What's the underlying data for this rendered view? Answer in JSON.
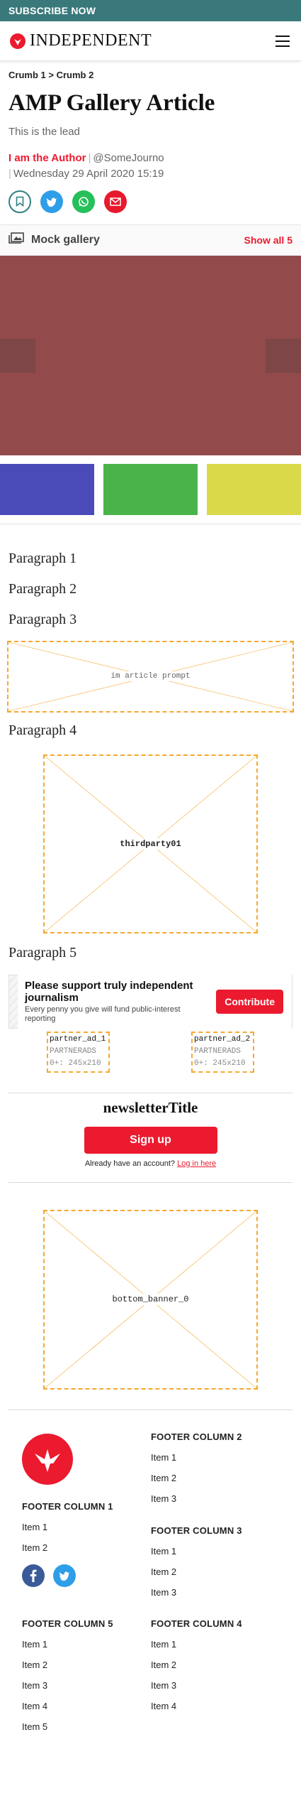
{
  "subscribe": {
    "label": "SUBSCRIBE NOW"
  },
  "header": {
    "logo_text": "INDEPENDENT"
  },
  "breadcrumb": {
    "items": [
      "Crumb 1",
      "Crumb 2"
    ],
    "separator": ">"
  },
  "article": {
    "title": "AMP Gallery Article",
    "lead": "This is the lead",
    "author": "I am the Author",
    "handle": "@SomeJourno",
    "date": "Wednesday 29 April 2020 15:19"
  },
  "gallery": {
    "title": "Mock gallery",
    "show_all": "Show all 5",
    "main_color": "#924a4a",
    "thumb_colors": [
      "#4a4ab9",
      "#4ab44a",
      "#d9d94a"
    ]
  },
  "paragraphs": [
    "Paragraph 1",
    "Paragraph 2",
    "Paragraph 3",
    "Paragraph 4",
    "Paragraph 5"
  ],
  "placeholders": {
    "prompt": "im article prompt",
    "thirdparty": "thirdparty01",
    "bottom_banner": "bottom_banner_0"
  },
  "support": {
    "heading": "Please support truly independent journalism",
    "body": "Every penny you give will fund public-interest reporting",
    "button": "Contribute"
  },
  "partners": [
    {
      "name": "partner_ad_1",
      "network": "PARTNERADS",
      "size": "0+: 245x210"
    },
    {
      "name": "partner_ad_2",
      "network": "PARTNERADS",
      "size": "0+: 245x210"
    }
  ],
  "newsletter": {
    "title": "newsletterTitle",
    "signup": "Sign up",
    "account_text": "Already have an account?",
    "login_link": "Log in here"
  },
  "footer": {
    "col1": {
      "title": "FOOTER COLUMN 1",
      "items": [
        "Item 1",
        "Item 2"
      ]
    },
    "col2": {
      "title": "FOOTER COLUMN 2",
      "items": [
        "Item 1",
        "Item 2",
        "Item 3"
      ]
    },
    "col3": {
      "title": "FOOTER COLUMN 3",
      "items": [
        "Item 1",
        "Item 2",
        "Item 3"
      ]
    },
    "col4": {
      "title": "FOOTER COLUMN 4",
      "items": [
        "Item 1",
        "Item 2",
        "Item 3",
        "Item 4"
      ]
    },
    "col5": {
      "title": "FOOTER COLUMN 5",
      "items": [
        "Item 1",
        "Item 2",
        "Item 3",
        "Item 4",
        "Item 5"
      ]
    }
  },
  "colors": {
    "brand_red": "#ec1a2e",
    "subscribe_teal": "#39787b",
    "placeholder_orange": "#f7a830"
  }
}
